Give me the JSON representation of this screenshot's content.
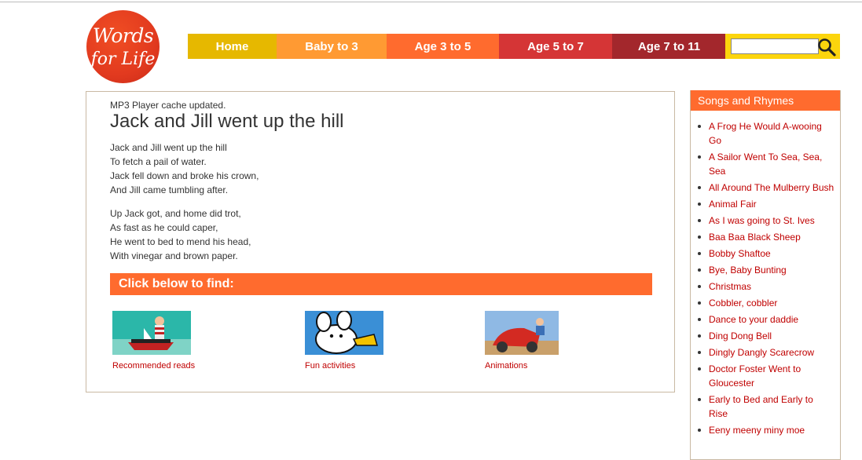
{
  "logo": {
    "line1": "Words",
    "line2": "for Life"
  },
  "nav": {
    "items": [
      {
        "label": "Home"
      },
      {
        "label": "Baby to 3"
      },
      {
        "label": "Age 3 to 5"
      },
      {
        "label": "Age 5 to 7"
      },
      {
        "label": "Age 7 to 11"
      }
    ]
  },
  "search": {
    "value": "",
    "placeholder": ""
  },
  "main": {
    "cache_notice": "MP3 Player cache updated.",
    "title": "Jack and Jill went up the hill",
    "stanza1": [
      "Jack and Jill went up the hill",
      "To fetch a pail of water.",
      "Jack fell down and broke his crown,",
      "And Jill came tumbling after."
    ],
    "stanza2": [
      "Up Jack got, and home did trot,",
      "As fast as he could caper,",
      "He went to bed to mend his head,",
      "With vinegar and brown paper."
    ],
    "find_heading": "Click below to find:",
    "cards": [
      {
        "label": "Recommended reads"
      },
      {
        "label": "Fun activities"
      },
      {
        "label": "Animations"
      }
    ]
  },
  "sidebar": {
    "heading": "Songs and Rhymes",
    "items": [
      "A Frog He Would A-wooing Go",
      "A Sailor Went To Sea, Sea, Sea",
      "All Around The Mulberry Bush",
      "Animal Fair",
      "As I was going to St. Ives",
      "Baa Baa Black Sheep",
      "Bobby Shaftoe",
      "Bye, Baby Bunting",
      "Christmas",
      "Cobbler, cobbler",
      "Dance to your daddie",
      "Ding Dong Bell",
      "Dingly Dangly Scarecrow",
      "Doctor Foster Went to Gloucester",
      "Early to Bed and Early to Rise",
      "Eeny meeny miny moe"
    ]
  },
  "colors": {
    "home": "#e6b800",
    "baby": "#ff9a33",
    "age35": "#ff6b2e",
    "age57": "#d53536",
    "age711": "#a3272c",
    "search_bg": "#fcd50d",
    "link": "#c00000"
  }
}
